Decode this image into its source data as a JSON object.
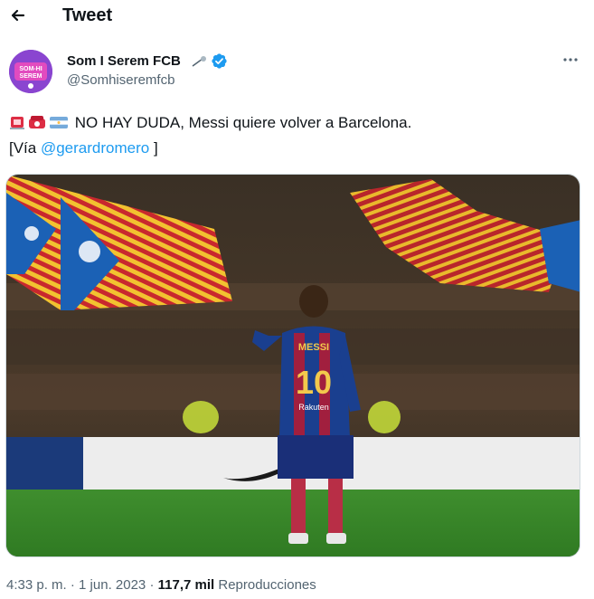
{
  "header": {
    "title": "Tweet",
    "back_icon": "arrow-left-icon"
  },
  "author": {
    "display_name": "Som I Serem FCB",
    "handle": "@Somhiseremfcb",
    "verified": true,
    "avatar_text_top": "SOM-HI",
    "avatar_text_bottom": "SEREM",
    "colors": {
      "avatar_bg": "#7b3ec4",
      "verified": "#1d9bf0"
    }
  },
  "tweet": {
    "line1_text": "NO HAY DUDA, Messi quiere volver a Barcelona.",
    "line2_prefix": "[Vía ",
    "line2_mention": "@gerardromero",
    "line2_suffix": " ]",
    "emojis": [
      "rotating-light-emoji",
      "telephone-emoji",
      "argentina-flag-emoji"
    ],
    "image": {
      "description_icon": "photo-messi-camp-nou",
      "shirt_name": "MESSI",
      "shirt_number": "10",
      "sponsor": "Rakuten"
    }
  },
  "meta": {
    "time": "4:33 p. m.",
    "separator": " · ",
    "date": "1 jun. 2023",
    "views_count": "117,7 mil",
    "views_label": "Reproducciones"
  },
  "colors": {
    "accent": "#1d9bf0",
    "muted": "#536471",
    "text": "#0f1419"
  }
}
